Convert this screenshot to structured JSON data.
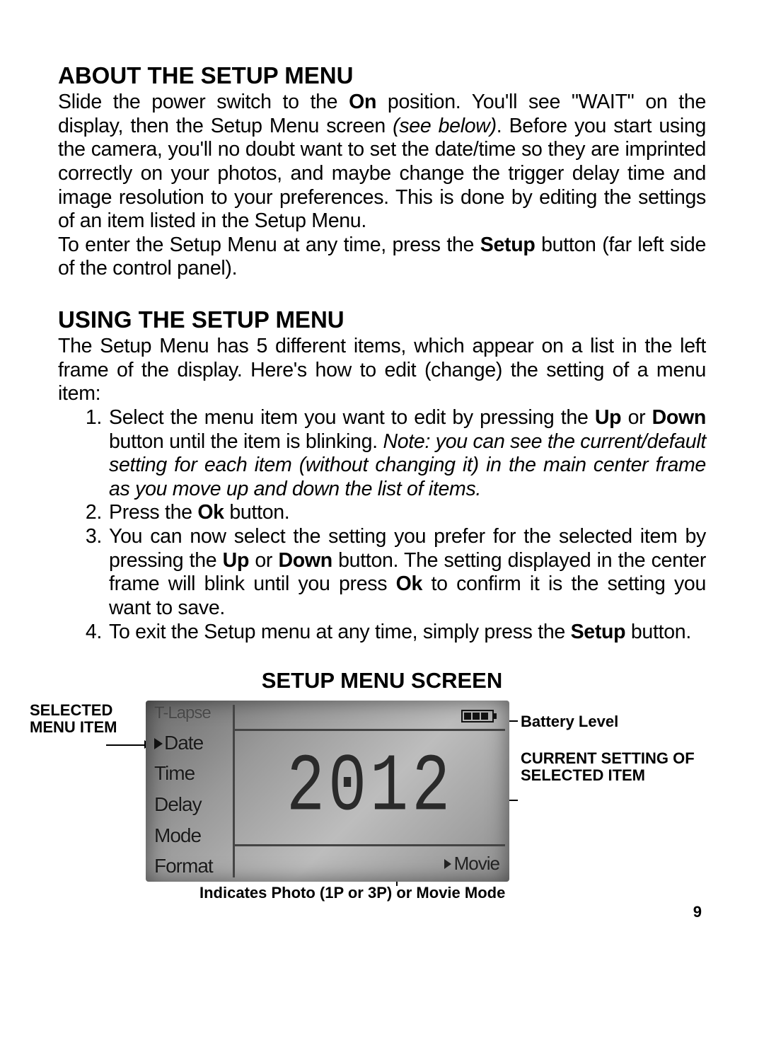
{
  "page_number": "9",
  "sections": {
    "about": {
      "heading": "ABOUT THE SETUP MENU",
      "p1_a": "Slide the power switch to the ",
      "p1_b": "On",
      "p1_c": " position. You'll see \"WAIT\" on the display, then the Setup Menu screen ",
      "p1_d": "(see below)",
      "p1_e": ". Before you start using the camera, you'll no doubt want to set the date/time so they are imprinted correctly on your photos, and maybe change the trigger delay time and image resolution to your preferences. This is done by editing the settings of an item listed in the Setup Menu.",
      "p2_a": "To enter the Setup Menu at any time, press the ",
      "p2_b": "Setup",
      "p2_c": " button (far left side of the control panel)."
    },
    "using": {
      "heading": "USING THE SETUP MENU",
      "intro": "The Setup Menu has 5 different items, which appear on a list in the left frame of the display. Here's how to edit (change) the setting of a menu item:",
      "s1_a": "Select the menu item you want to edit by pressing the ",
      "s1_b": "Up",
      "s1_c": " or ",
      "s1_d": "Down",
      "s1_e": " button until the item is blinking. ",
      "s1_f": "Note: you can see the current/default setting for each item (without changing it) in the main center frame as you move up and down the list of items.",
      "s2_a": "Press the ",
      "s2_b": "Ok",
      "s2_c": " button.",
      "s3_a": "You can now select the setting you prefer for the selected item by pressing the ",
      "s3_b": "Up",
      "s3_c": " or ",
      "s3_d": "Down",
      "s3_e": " button. The setting displayed in the center frame will blink until you press ",
      "s3_f": "Ok",
      "s3_g": " to confirm it is the setting you want to save.",
      "s4_a": "To exit the Setup menu at any time, simply press the ",
      "s4_b": "Setup",
      "s4_c": " button."
    }
  },
  "diagram": {
    "title": "SETUP MENU SCREEN",
    "callouts": {
      "selected_menu_item": "Selected Menu Item",
      "battery_level": "Battery Level",
      "current_setting": "Current Setting of Selected Item",
      "mode_indicator": "Indicates Photo (1P or 3P) or Movie Mode"
    },
    "lcd": {
      "menu_top_clipped": "T-Lapse",
      "menu_items": [
        "Date",
        "Time",
        "Delay",
        "Mode",
        "Format"
      ],
      "selected_index": 0,
      "center_value": "2012",
      "bottom_mode": "Movie"
    }
  }
}
